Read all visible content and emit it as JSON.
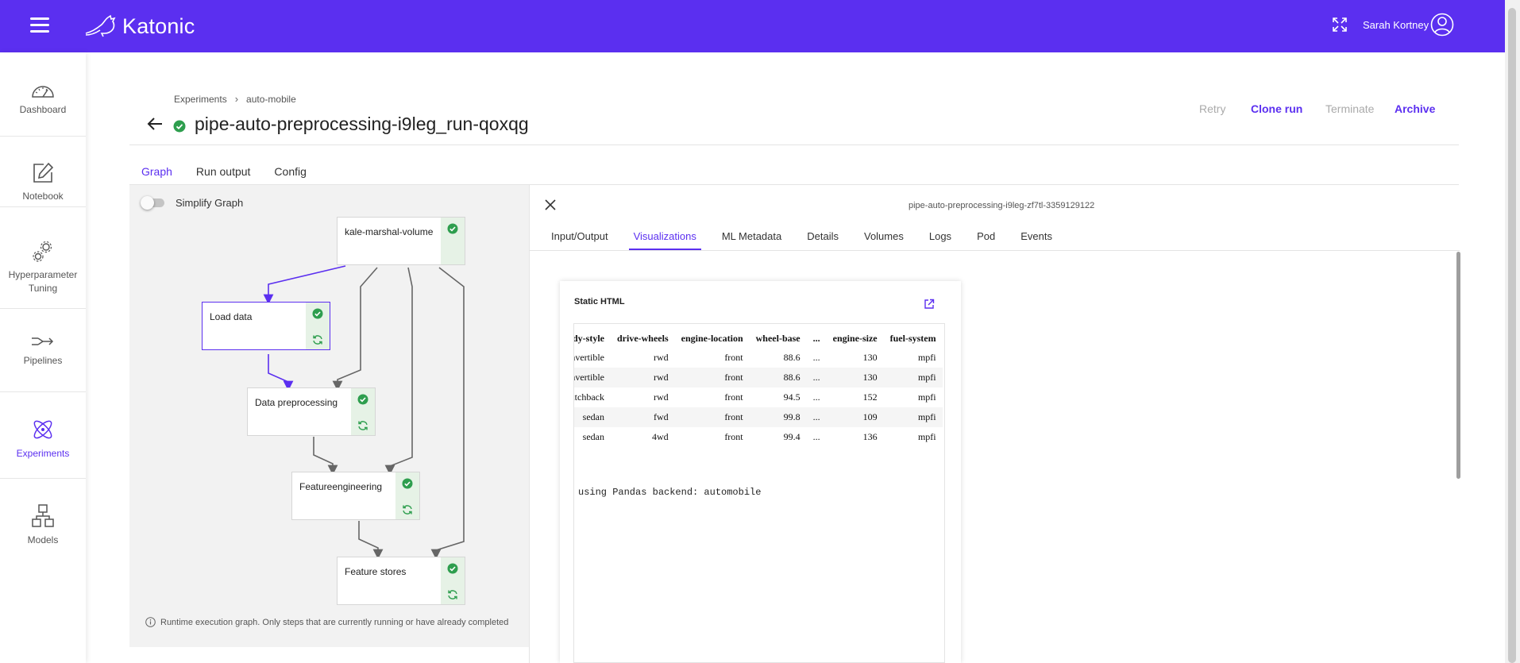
{
  "app": {
    "brand": "Katonic",
    "user_name": "Sarah Kortney",
    "accent_color": "#5b2ff0",
    "success_color": "#2e9e4e"
  },
  "sidebar": {
    "items": [
      {
        "label": "Dashboard",
        "icon": "speedometer-icon"
      },
      {
        "label": "Notebook",
        "icon": "edit-icon"
      },
      {
        "label": "Hyperparameter Tuning",
        "icon": "gears-icon"
      },
      {
        "label": "Pipelines",
        "icon": "pipeline-icon"
      },
      {
        "label": "Experiments",
        "icon": "atom-icon",
        "active": true
      },
      {
        "label": "Models",
        "icon": "models-icon"
      }
    ]
  },
  "breadcrumb": {
    "root": "Experiments",
    "current": "auto-mobile"
  },
  "run": {
    "title": "pipe-auto-preprocessing-i9leg_run-qoxqg",
    "status": "succeeded"
  },
  "actions": {
    "retry": "Retry",
    "clone": "Clone run",
    "terminate": "Terminate",
    "archive": "Archive"
  },
  "main_tabs": [
    "Graph",
    "Run output",
    "Config"
  ],
  "graph": {
    "simplify_label": "Simplify Graph",
    "simplify_on": false,
    "nodes": [
      {
        "label": "kale-marshal-volume",
        "status": "succeeded"
      },
      {
        "label": "Load data",
        "status": "succeeded",
        "selected": true
      },
      {
        "label": "Data preprocessing",
        "status": "succeeded"
      },
      {
        "label": "Featureengineering",
        "status": "succeeded"
      },
      {
        "label": "Feature stores",
        "status": "succeeded"
      }
    ],
    "note": "Runtime execution graph. Only steps that are currently running or have already completed"
  },
  "detail": {
    "pod_name": "pipe-auto-preprocessing-i9leg-zf7tl-3359129122",
    "tabs": [
      "Input/Output",
      "Visualizations",
      "ML Metadata",
      "Details",
      "Volumes",
      "Logs",
      "Pod",
      "Events"
    ],
    "active_tab": "Visualizations",
    "viz": {
      "title": "Static HTML",
      "table": {
        "headers": [
          "body-style",
          "drive-wheels",
          "engine-location",
          "wheel-base",
          "...",
          "engine-size",
          "fuel-system"
        ],
        "rows": [
          [
            "convertible",
            "rwd",
            "front",
            "88.6",
            "...",
            "130",
            "mpfi"
          ],
          [
            "convertible",
            "rwd",
            "front",
            "88.6",
            "...",
            "130",
            "mpfi"
          ],
          [
            "hatchback",
            "rwd",
            "front",
            "94.5",
            "...",
            "152",
            "mpfi"
          ],
          [
            "sedan",
            "fwd",
            "front",
            "99.8",
            "...",
            "109",
            "mpfi"
          ],
          [
            "sedan",
            "4wd",
            "front",
            "99.4",
            "...",
            "136",
            "mpfi"
          ]
        ]
      },
      "footer_text": "using Pandas backend: automobile"
    }
  }
}
